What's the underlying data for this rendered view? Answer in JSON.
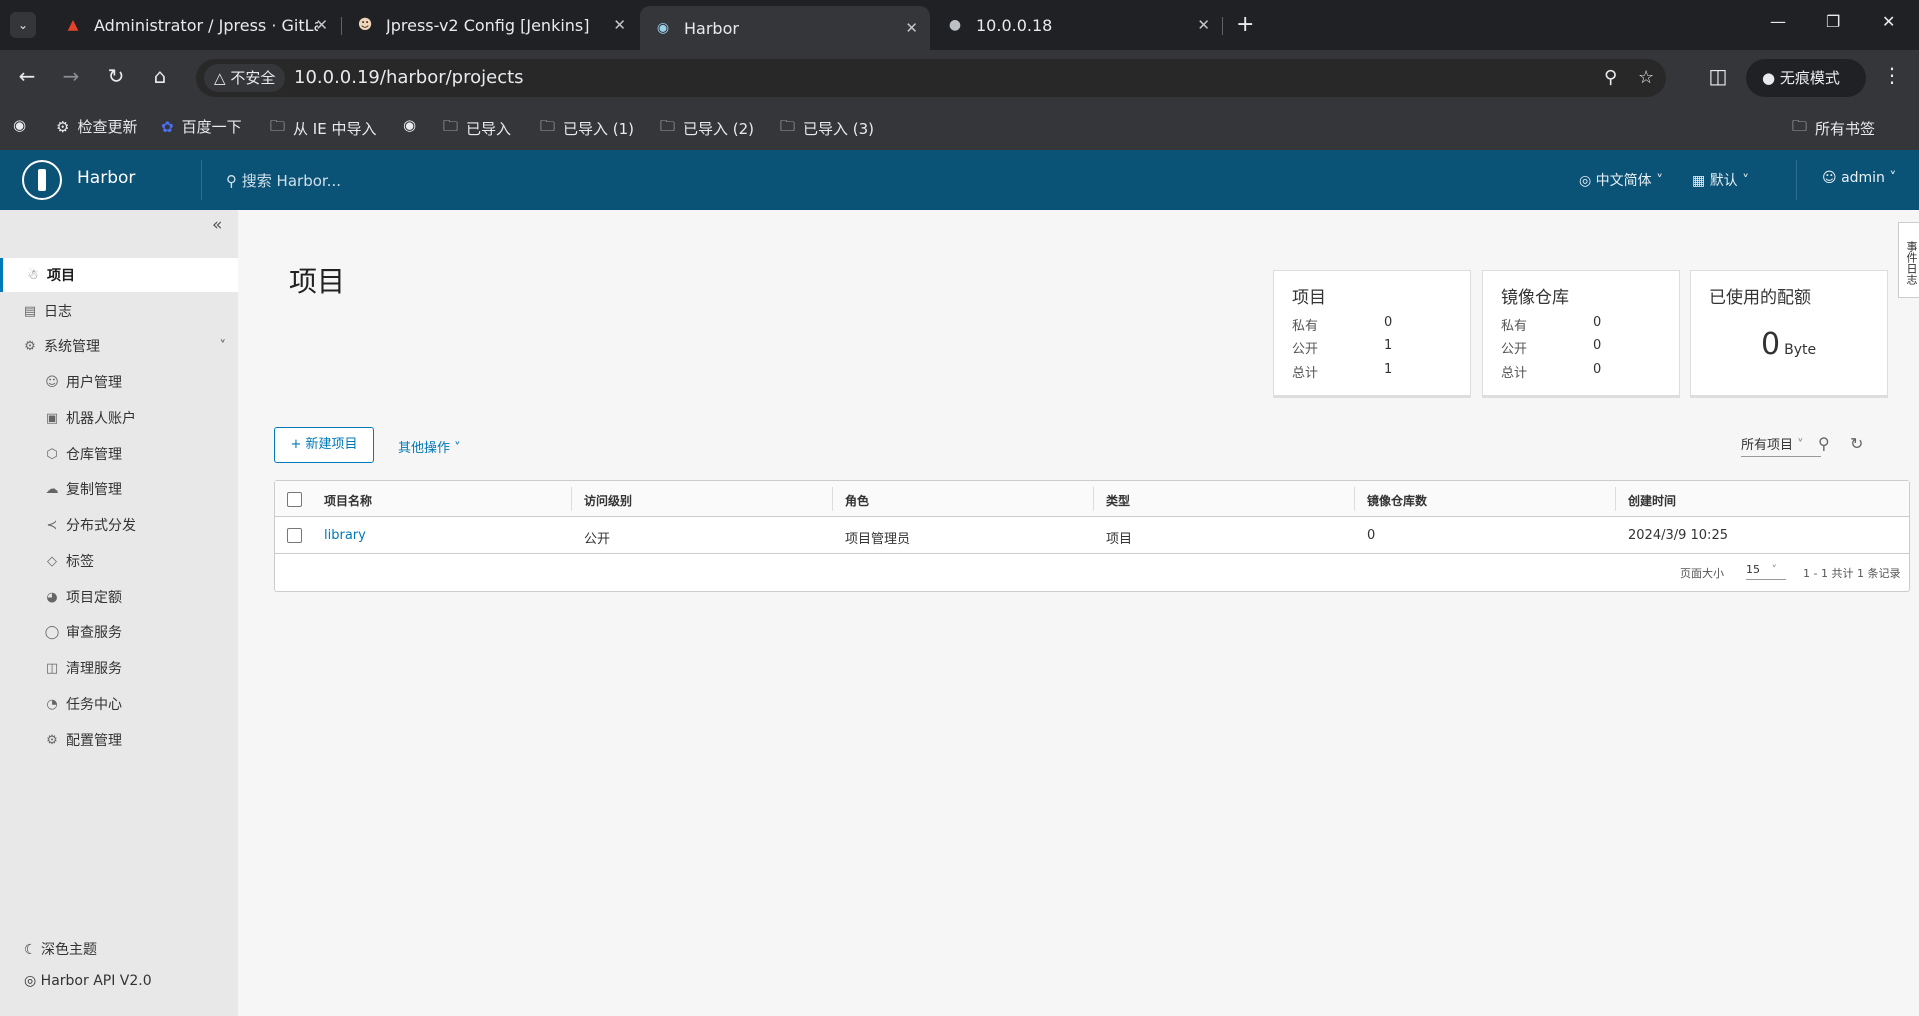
{
  "browser": {
    "tabs": [
      {
        "title": "Administrator / Jpress · GitLa",
        "icon": "gitlab-icon"
      },
      {
        "title": "Jpress-v2 Config [Jenkins]",
        "icon": "jenkins-icon"
      },
      {
        "title": "Harbor",
        "icon": "harbor-favicon",
        "active": true
      },
      {
        "title": "10.0.0.18",
        "icon": "globe-icon"
      }
    ],
    "security_label": "不安全",
    "url": "10.0.0.19/harbor/projects",
    "incognito_label": "无痕模式",
    "bookmarks": [
      {
        "label": "",
        "icon": "globe-icon"
      },
      {
        "label": "检查更新",
        "icon": "gear-icon"
      },
      {
        "label": "百度一下",
        "icon": "baidu-icon"
      },
      {
        "label": "从 IE 中导入",
        "icon": "folder-icon"
      },
      {
        "label": "",
        "icon": "globe-icon"
      },
      {
        "label": "已导入",
        "icon": "folder-icon"
      },
      {
        "label": "已导入 (1)",
        "icon": "folder-icon"
      },
      {
        "label": "已导入 (2)",
        "icon": "folder-icon"
      },
      {
        "label": "已导入 (3)",
        "icon": "folder-icon"
      }
    ],
    "all_bookmarks": "所有书签"
  },
  "header": {
    "brand": "Harbor",
    "search_placeholder": "搜索 Harbor...",
    "language": "中文简体",
    "datetime_format": "默认",
    "user": "admin"
  },
  "sidebar": {
    "items": [
      {
        "label": "项目",
        "icon": "projects-icon",
        "active": true
      },
      {
        "label": "日志",
        "icon": "logs-icon"
      },
      {
        "label": "系统管理",
        "icon": "admin-icon",
        "expandable": true
      }
    ],
    "sub_items": [
      {
        "label": "用户管理",
        "icon": "users-icon"
      },
      {
        "label": "机器人账户",
        "icon": "robot-icon"
      },
      {
        "label": "仓库管理",
        "icon": "registry-icon"
      },
      {
        "label": "复制管理",
        "icon": "replication-icon"
      },
      {
        "label": "分布式分发",
        "icon": "distribution-icon"
      },
      {
        "label": "标签",
        "icon": "tag-icon"
      },
      {
        "label": "项目定额",
        "icon": "quota-icon"
      },
      {
        "label": "审查服务",
        "icon": "shield-icon"
      },
      {
        "label": "清理服务",
        "icon": "trash-icon"
      },
      {
        "label": "任务中心",
        "icon": "dashboard-icon"
      },
      {
        "label": "配置管理",
        "icon": "settings-icon"
      }
    ],
    "dark_theme": "深色主题",
    "api": "Harbor API V2.0"
  },
  "main": {
    "title": "项目",
    "cards": {
      "projects": {
        "title": "项目",
        "rows": [
          {
            "label": "私有",
            "value": "0"
          },
          {
            "label": "公开",
            "value": "1"
          },
          {
            "label": "总计",
            "value": "1"
          }
        ]
      },
      "repos": {
        "title": "镜像仓库",
        "rows": [
          {
            "label": "私有",
            "value": "0"
          },
          {
            "label": "公开",
            "value": "0"
          },
          {
            "label": "总计",
            "value": "0"
          }
        ]
      },
      "quota": {
        "title": "已使用的配额",
        "value": "0",
        "unit": "Byte"
      }
    },
    "new_project": "新建项目",
    "other_actions": "其他操作",
    "filter": "所有项目",
    "columns": [
      "项目名称",
      "访问级别",
      "角色",
      "类型",
      "镜像仓库数",
      "创建时间"
    ],
    "rows": [
      {
        "name": "library",
        "access": "公开",
        "role": "项目管理员",
        "type": "项目",
        "repos": "0",
        "created": "2024/3/9 10:25"
      }
    ],
    "page_size_label": "页面大小",
    "page_size": "15",
    "total_label": "1 - 1 共计 1 条记录",
    "event_log": "事件日志"
  }
}
